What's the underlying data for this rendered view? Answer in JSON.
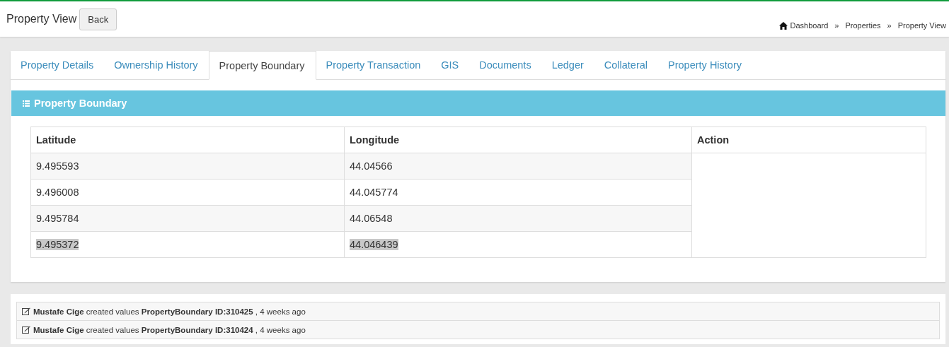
{
  "page": {
    "title": "Property View",
    "back_button": "Back"
  },
  "breadcrumb": [
    "Dashboard",
    "Properties",
    "Property View"
  ],
  "breadcrumb_separator": "»",
  "tabs": [
    {
      "label": "Property Details",
      "selected": false
    },
    {
      "label": "Ownership History",
      "selected": false
    },
    {
      "label": "Property Boundary",
      "selected": true
    },
    {
      "label": "Property Transaction",
      "selected": false
    },
    {
      "label": "GIS",
      "selected": false
    },
    {
      "label": "Documents",
      "selected": false
    },
    {
      "label": "Ledger",
      "selected": false
    },
    {
      "label": "Collateral",
      "selected": false
    },
    {
      "label": "Property History",
      "selected": false
    }
  ],
  "panel": {
    "title": "Property Boundary"
  },
  "table": {
    "columns": [
      "Latitude",
      "Longitude",
      "Action"
    ],
    "rows": [
      {
        "latitude": "9.495593",
        "longitude": "44.04566",
        "highlighted": false
      },
      {
        "latitude": "9.496008",
        "longitude": "44.045774",
        "highlighted": false
      },
      {
        "latitude": "9.495784",
        "longitude": "44.06548",
        "highlighted": false
      },
      {
        "latitude": "9.495372",
        "longitude": "44.046439",
        "highlighted": true
      }
    ]
  },
  "activity_log": [
    "**Mustafe Cige** created values **PropertyBoundary ID:310425** , 4 weeks ago",
    "**Mustafe Cige** created values **PropertyBoundary ID:310424** , 4 weeks ago"
  ]
}
